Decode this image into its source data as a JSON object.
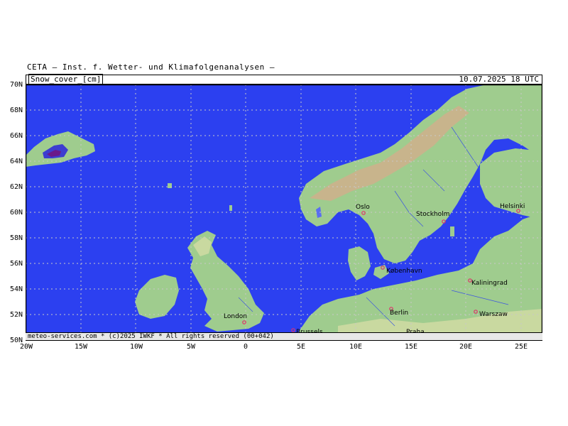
{
  "header": "CETA — Inst. f. Wetter- und Klimafolgenanalysen —",
  "field_label": "Snow_cover_[cm]",
  "datetime": "10.07.2025 18 UTC",
  "footer": "meteo-services.com * (c)2025 IWKF * All rights reserved (00+042)",
  "y_ticks": [
    "70N",
    "68N",
    "66N",
    "64N",
    "62N",
    "60N",
    "58N",
    "56N",
    "54N",
    "52N",
    "50N"
  ],
  "x_ticks": [
    "20W",
    "15W",
    "10W",
    "5W",
    "0",
    "5E",
    "10E",
    "15E",
    "20E",
    "25E"
  ],
  "cities": [
    {
      "name": "Oslo"
    },
    {
      "name": "Stockholm"
    },
    {
      "name": "Helsinki"
    },
    {
      "name": "København"
    },
    {
      "name": "Kaliningrad"
    },
    {
      "name": "London"
    },
    {
      "name": "Berlin"
    },
    {
      "name": "Warszaw"
    },
    {
      "name": "Brussels"
    },
    {
      "name": "Praha"
    }
  ],
  "colors": {
    "sea": "#2c40f0",
    "land_low": "#9fcc8e",
    "land_mid": "#c9d9a0",
    "land_high": "#c8b48c",
    "snow_light": "#5a6ef0",
    "snow_mid": "#3d3dd0",
    "snow_deep": "#6a1a8a"
  }
}
